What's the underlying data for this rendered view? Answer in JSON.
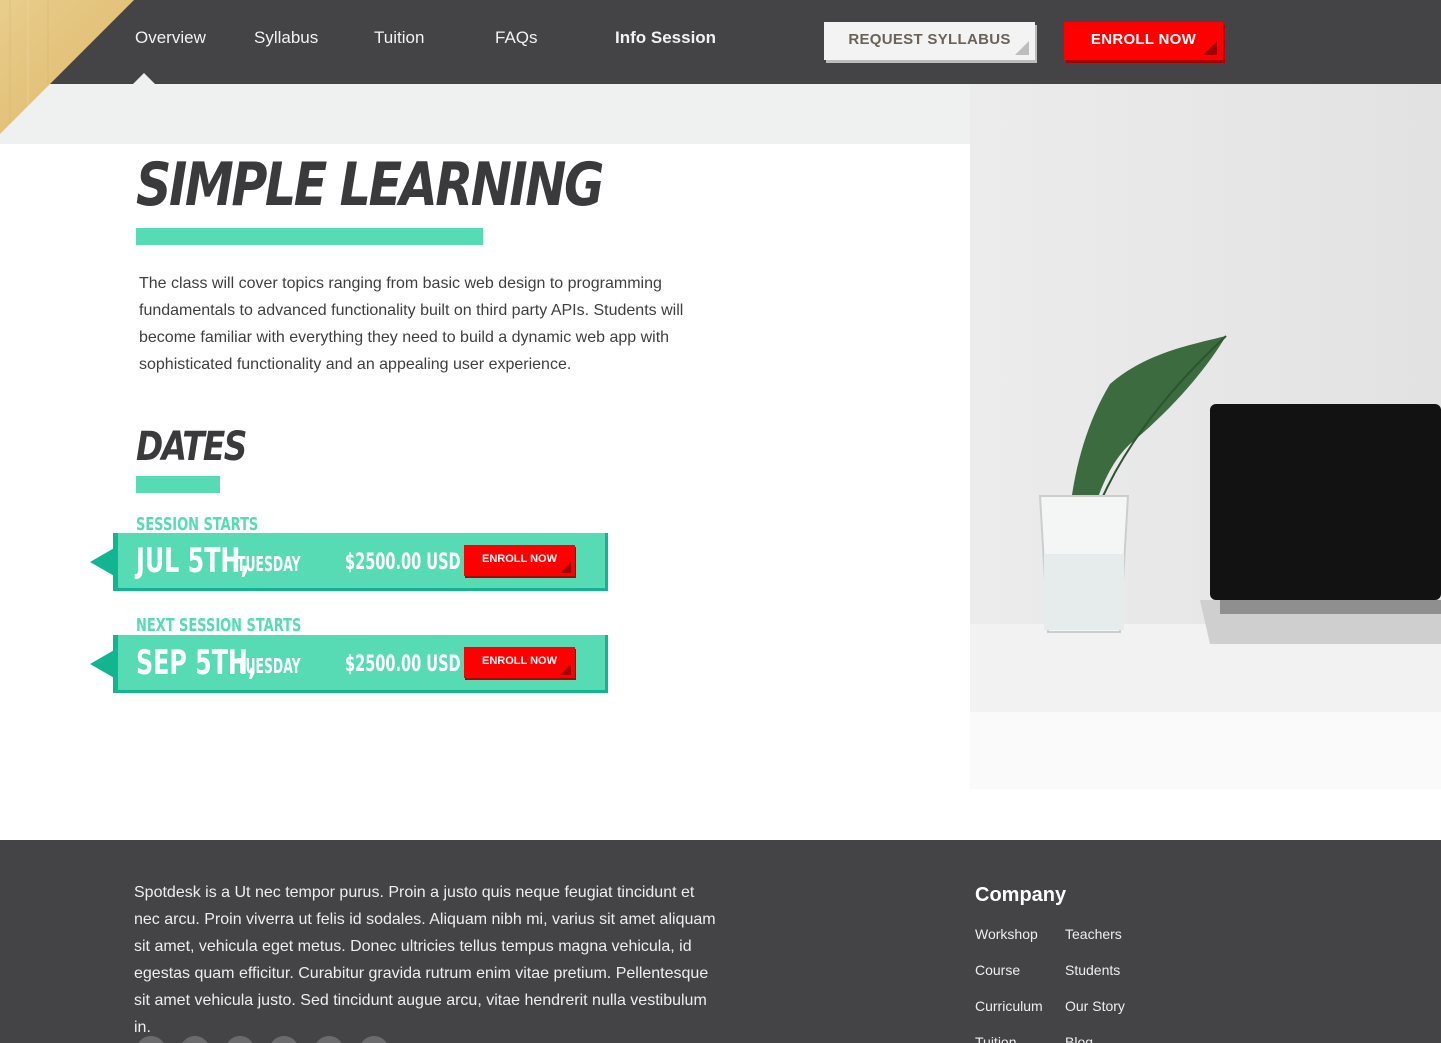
{
  "nav": {
    "items": [
      {
        "label": "Overview"
      },
      {
        "label": "Syllabus"
      },
      {
        "label": "Tuition"
      },
      {
        "label": "FAQs"
      },
      {
        "label": "Info Session"
      }
    ],
    "active": "Overview"
  },
  "header_buttons": {
    "request_syllabus": "REQUEST SYLLABUS",
    "enroll_now": "ENROLL NOW"
  },
  "hero": {
    "title": "SIMPLE LEARNING",
    "intro": "The class will cover topics ranging from basic web design to programming fundamentals to advanced functionality built on third party APIs. Students will become familiar with everything they need to build a dynamic web app with sophisticated functionality and an appealing user experience."
  },
  "dates": {
    "title": "DATES",
    "sessions": [
      {
        "label": "SESSION STARTS",
        "date": "JUL 5TH,",
        "day": "TUESDAY",
        "price": "$2500.00 USD",
        "button": "ENROLL NOW"
      },
      {
        "label": "NEXT SESSION STARTS",
        "date": "SEP 5TH,",
        "day": "TUESDAY",
        "price": "$2500.00 USD",
        "button": "ENROLL NOW"
      }
    ]
  },
  "footer": {
    "about": "Spotdesk is a Ut nec tempor purus. Proin a justo quis neque feugiat tincidunt et nec arcu. Proin viverra ut felis id sodales. Aliquam nibh mi, varius sit amet aliquam sit amet, vehicula eget metus. Donec ultricies tellus tempus magna vehicula, id egestas quam efficitur. Curabitur gravida rutrum enim vitae pretium. Pellentesque sit amet vehicula justo. Sed tincidunt augue arcu, vitae hendrerit nulla vestibulum in.",
    "company_title": "Company",
    "links_col1": [
      "Workshop",
      "Course",
      "Curriculum",
      "Tuition"
    ],
    "links_col2": [
      "Teachers",
      "Students",
      "Our Story",
      "Blog"
    ]
  },
  "colors": {
    "header_bg": "#444345",
    "accent_mint": "#57dbb5",
    "accent_teal": "#11b58f",
    "cta_red": "#ff0000",
    "corner_gold": "#e6c77f"
  },
  "icons": [
    "facebook-icon",
    "twitter-icon",
    "linkedin-icon",
    "instagram-icon",
    "youtube-icon",
    "pinterest-icon"
  ]
}
